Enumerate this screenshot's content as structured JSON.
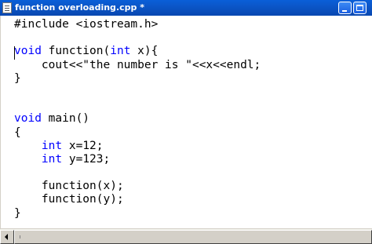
{
  "window": {
    "title": "function overloading.cpp *"
  },
  "editor": {
    "lines": [
      [
        {
          "t": "#include <iostream.h>",
          "c": "default"
        }
      ],
      [
        {
          "t": "",
          "c": "default"
        }
      ],
      [
        {
          "t": "void",
          "c": "keyword"
        },
        {
          "t": " function(",
          "c": "default"
        },
        {
          "t": "int",
          "c": "keyword"
        },
        {
          "t": " x){",
          "c": "default"
        }
      ],
      [
        {
          "t": "    cout<<\"the number is \"<<x<<endl;",
          "c": "default"
        }
      ],
      [
        {
          "t": "}",
          "c": "default"
        }
      ],
      [
        {
          "t": "",
          "c": "default"
        }
      ],
      [
        {
          "t": "",
          "c": "default"
        }
      ],
      [
        {
          "t": "void",
          "c": "keyword"
        },
        {
          "t": " main()",
          "c": "default"
        }
      ],
      [
        {
          "t": "{",
          "c": "default"
        }
      ],
      [
        {
          "t": "    ",
          "c": "default"
        },
        {
          "t": "int",
          "c": "keyword"
        },
        {
          "t": " x=12;",
          "c": "default"
        }
      ],
      [
        {
          "t": "    ",
          "c": "default"
        },
        {
          "t": "int",
          "c": "keyword"
        },
        {
          "t": " y=123;",
          "c": "default"
        }
      ],
      [
        {
          "t": "",
          "c": "default"
        }
      ],
      [
        {
          "t": "    function(x);",
          "c": "default"
        }
      ],
      [
        {
          "t": "    function(y);",
          "c": "default"
        }
      ],
      [
        {
          "t": "}",
          "c": "default"
        }
      ]
    ]
  },
  "colors": {
    "keyword": "#0000ff",
    "default": "#000000",
    "titlebar": "#0a5fd8"
  },
  "icons": {
    "app": "document-icon",
    "minimize": "minimize-icon",
    "maximize": "maximize-icon",
    "scroll_left": "arrow-left-icon"
  }
}
